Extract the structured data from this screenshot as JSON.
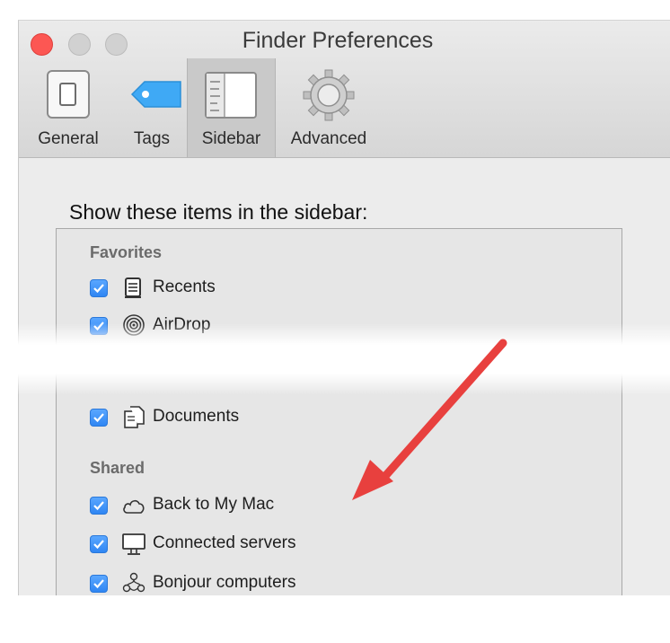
{
  "window": {
    "title": "Finder Preferences"
  },
  "toolbar": {
    "items": [
      {
        "label": "General",
        "icon": "general-switch-icon"
      },
      {
        "label": "Tags",
        "icon": "tag-icon"
      },
      {
        "label": "Sidebar",
        "icon": "sidebar-icon",
        "selected": true
      },
      {
        "label": "Advanced",
        "icon": "gear-icon"
      }
    ]
  },
  "content": {
    "heading": "Show these items in the sidebar:",
    "favorites": {
      "label": "Favorites",
      "items": [
        {
          "label": "Recents",
          "checked": true,
          "icon": "recents-icon"
        },
        {
          "label": "AirDrop",
          "checked": true,
          "icon": "airdrop-icon"
        },
        {
          "label": "Documents",
          "checked": true,
          "icon": "documents-icon"
        }
      ]
    },
    "shared": {
      "label": "Shared",
      "items": [
        {
          "label": "Back to My Mac",
          "checked": true,
          "icon": "cloud-icon"
        },
        {
          "label": "Connected servers",
          "checked": true,
          "icon": "monitor-icon"
        },
        {
          "label": "Bonjour computers",
          "checked": true,
          "icon": "bonjour-icon"
        }
      ]
    }
  },
  "colors": {
    "accent": "#2f86f3",
    "arrow": "#e8403e",
    "close_button": "#fc5753"
  }
}
